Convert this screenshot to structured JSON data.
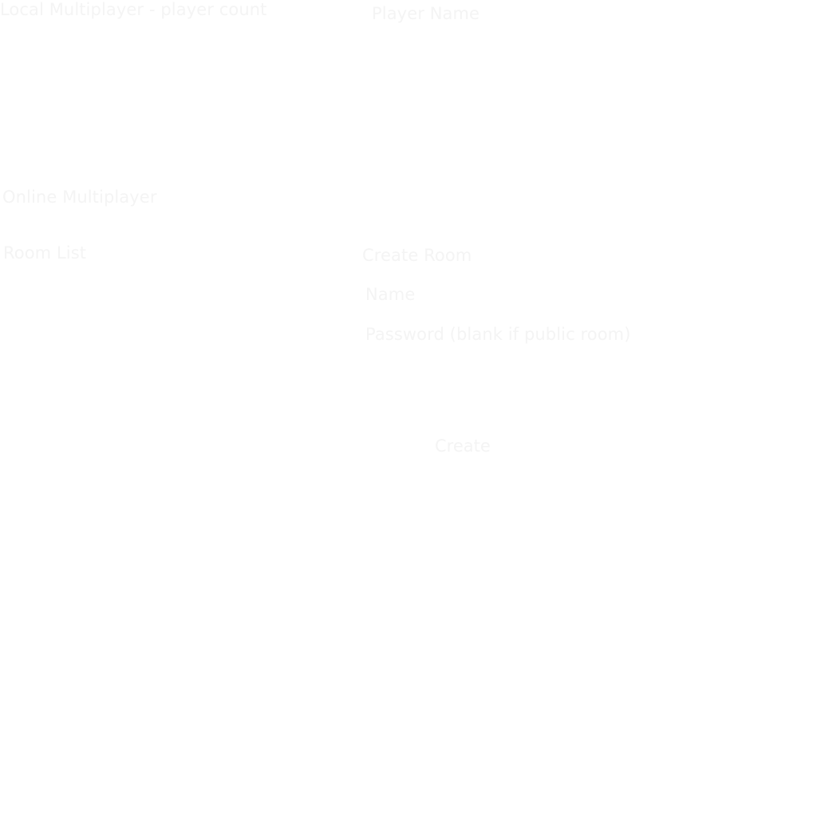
{
  "local": {
    "heading": "Local Multiplayer - player count"
  },
  "player": {
    "name_label": "Player Name"
  },
  "online": {
    "heading": "Online Multiplayer",
    "room_list_label": "Room List"
  },
  "create_room": {
    "heading": "Create Room",
    "name_label": "Name",
    "password_label": "Password (blank if public room)",
    "create_button": "Create"
  },
  "colors": {
    "background": "#ffffff",
    "text": "#f4f4f4"
  }
}
